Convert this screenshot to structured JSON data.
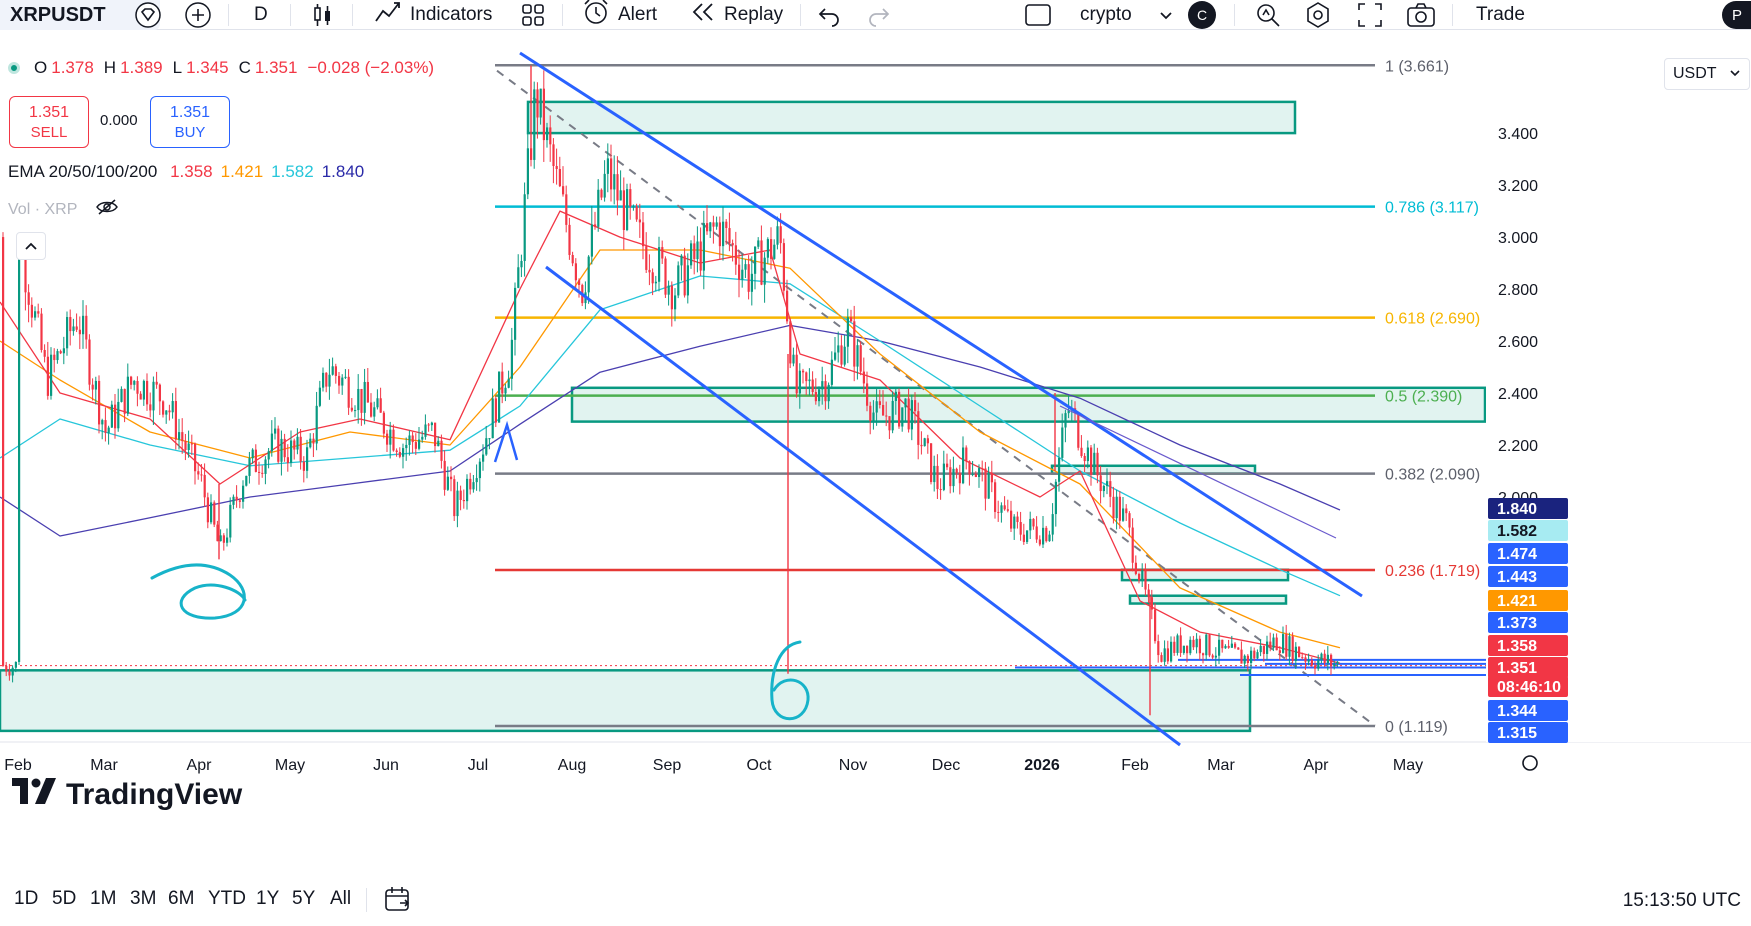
{
  "toolbar": {
    "symbol": "XRPUSDT",
    "interval": "D",
    "indicators_label": "Indicators",
    "alert_label": "Alert",
    "replay_label": "Replay",
    "layout_name": "crypto",
    "avatar_letter": "C",
    "trade_label": "Trade",
    "profile_letter": "P",
    "icons": [
      "diamond-icon",
      "plus-icon",
      "candles-icon",
      "indicators-icon",
      "templates-icon",
      "alert-icon",
      "replay-icon",
      "undo-icon",
      "redo-icon",
      "layout-icon",
      "chevron-down-icon",
      "search-zoom-icon",
      "settings-icon",
      "fullscreen-icon",
      "camera-icon"
    ]
  },
  "legend": {
    "open_label": "O",
    "open": "1.378",
    "high_label": "H",
    "high": "1.389",
    "low_label": "L",
    "low": "1.345",
    "close_label": "C",
    "close": "1.351",
    "change": "−0.028 (−2.03%)",
    "sell_price": "1.351",
    "sell_label": "SELL",
    "spread": "0.000",
    "buy_price": "1.351",
    "buy_label": "BUY",
    "ema_label": "EMA 20/50/100/200",
    "ema_values": [
      "1.358",
      "1.421",
      "1.582",
      "1.840"
    ],
    "ema_colors": [
      "#f23645",
      "#ff9800",
      "#26c6da",
      "#2a2aa8"
    ],
    "vol_label": "Vol · XRP"
  },
  "currency": "USDT",
  "watermark": "TradingView",
  "bottom": {
    "ranges": [
      "1D",
      "5D",
      "1M",
      "3M",
      "6M",
      "YTD",
      "1Y",
      "5Y",
      "All"
    ],
    "clock": "15:13:50 UTC"
  },
  "chart_data": {
    "type": "candlestick",
    "symbol": "XRPUSDT",
    "interval": "D",
    "x_ticks": [
      "Feb",
      "Mar",
      "Apr",
      "May",
      "Jun",
      "Jul",
      "Aug",
      "Sep",
      "Oct",
      "Nov",
      "Dec",
      "2026",
      "Feb",
      "Mar",
      "Apr",
      "May"
    ],
    "y_ticks": [
      "3.400",
      "3.200",
      "3.000",
      "2.800",
      "2.600",
      "2.400",
      "2.200",
      "2.000"
    ],
    "ylim": [
      1.11,
      3.7
    ],
    "price_series": [
      [
        "2025-02-01",
        3.0
      ],
      [
        "2025-02-10",
        2.45
      ],
      [
        "2025-02-20",
        2.7
      ],
      [
        "2025-03-01",
        2.25
      ],
      [
        "2025-03-10",
        2.45
      ],
      [
        "2025-03-20",
        2.38
      ],
      [
        "2025-04-01",
        2.05
      ],
      [
        "2025-04-07",
        1.79
      ],
      [
        "2025-04-15",
        2.1
      ],
      [
        "2025-04-25",
        2.2
      ],
      [
        "2025-05-05",
        2.15
      ],
      [
        "2025-05-12",
        2.5
      ],
      [
        "2025-05-25",
        2.35
      ],
      [
        "2025-06-05",
        2.2
      ],
      [
        "2025-06-15",
        2.25
      ],
      [
        "2025-06-22",
        1.95
      ],
      [
        "2025-07-01",
        2.2
      ],
      [
        "2025-07-10",
        2.55
      ],
      [
        "2025-07-18",
        3.55
      ],
      [
        "2025-07-25",
        3.2
      ],
      [
        "2025-08-02",
        2.8
      ],
      [
        "2025-08-10",
        3.25
      ],
      [
        "2025-08-20",
        3.0
      ],
      [
        "2025-09-01",
        2.8
      ],
      [
        "2025-09-15",
        3.05
      ],
      [
        "2025-09-25",
        2.85
      ],
      [
        "2025-10-05",
        3.0
      ],
      [
        "2025-10-10",
        2.4
      ],
      [
        "2025-10-20",
        2.45
      ],
      [
        "2025-10-27",
        2.65
      ],
      [
        "2025-11-05",
        2.3
      ],
      [
        "2025-11-15",
        2.35
      ],
      [
        "2025-11-25",
        2.05
      ],
      [
        "2025-12-05",
        2.15
      ],
      [
        "2025-12-20",
        1.87
      ],
      [
        "2025-12-31",
        1.88
      ],
      [
        "2026-01-06",
        2.35
      ],
      [
        "2026-01-15",
        2.1
      ],
      [
        "2026-01-25",
        1.9
      ],
      [
        "2026-02-05",
        1.4
      ],
      [
        "2026-02-15",
        1.45
      ],
      [
        "2026-02-25",
        1.4
      ],
      [
        "2026-03-05",
        1.38
      ],
      [
        "2026-03-15",
        1.45
      ],
      [
        "2026-03-25",
        1.38
      ],
      [
        "2026-04-05",
        1.351
      ]
    ],
    "fib_levels": [
      {
        "label": "1 (3.661)",
        "value": 3.661,
        "color": "#787b86"
      },
      {
        "label": "0.786 (3.117)",
        "value": 3.117,
        "color": "#00bcd4"
      },
      {
        "label": "0.618 (2.690)",
        "value": 2.69,
        "color": "#f7b500"
      },
      {
        "label": "0.5 (2.390)",
        "value": 2.39,
        "color": "#4caf50"
      },
      {
        "label": "0.382 (2.090)",
        "value": 2.09,
        "color": "#787b86"
      },
      {
        "label": "0.236 (1.719)",
        "value": 1.719,
        "color": "#e53935"
      },
      {
        "label": "0 (1.119)",
        "value": 1.119,
        "color": "#787b86"
      }
    ],
    "price_labels": [
      {
        "text": "1.840",
        "value": 1.84,
        "bg": "#1a237e",
        "fg": "#ffffff"
      },
      {
        "text": "1.582",
        "value": 1.582,
        "bg": "#a7ebf2",
        "fg": "#131722"
      },
      {
        "text": "1.474",
        "value": 1.474,
        "bg": "#2962ff",
        "fg": "#ffffff"
      },
      {
        "text": "1.443",
        "value": 1.443,
        "bg": "#2962ff",
        "fg": "#ffffff"
      },
      {
        "text": "1.421",
        "value": 1.421,
        "bg": "#ff9800",
        "fg": "#ffffff"
      },
      {
        "text": "1.373",
        "value": 1.373,
        "bg": "#2962ff",
        "fg": "#ffffff"
      },
      {
        "text": "1.358",
        "value": 1.358,
        "bg": "#f23645",
        "fg": "#ffffff"
      },
      {
        "text": "1.351",
        "value": 1.351,
        "bg": "#f23645",
        "fg": "#ffffff"
      },
      {
        "text": "08:46:10",
        "value": 1.351,
        "bg": "#f23645",
        "fg": "#ffffff"
      },
      {
        "text": "1.344",
        "value": 1.344,
        "bg": "#2962ff",
        "fg": "#ffffff"
      },
      {
        "text": "1.315",
        "value": 1.315,
        "bg": "#2962ff",
        "fg": "#ffffff"
      }
    ],
    "zones": [
      {
        "name": "supply-zone-top",
        "top": 3.52,
        "bottom": 3.4
      },
      {
        "name": "zone-0.5",
        "top": 2.42,
        "bottom": 2.29
      },
      {
        "name": "zone-2.1",
        "top": 2.12,
        "bottom": 2.09
      },
      {
        "name": "zone-1.7",
        "top": 1.72,
        "bottom": 1.68
      },
      {
        "name": "zone-1.6",
        "top": 1.62,
        "bottom": 1.59
      },
      {
        "name": "demand-zone-bottom",
        "top": 1.333,
        "bottom": 1.1
      }
    ],
    "annotations": [
      "6",
      "6"
    ]
  }
}
